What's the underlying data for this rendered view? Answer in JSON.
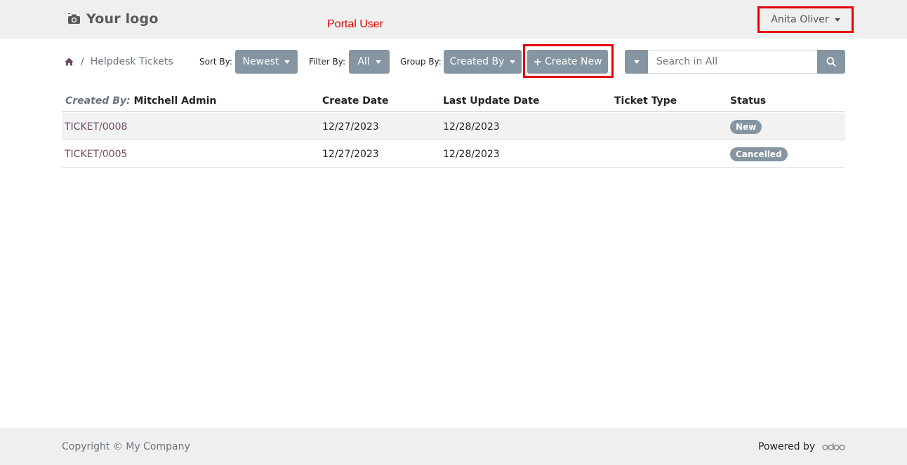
{
  "header": {
    "logo_text": "Your logo",
    "annotation": "Portal User",
    "user_name": "Anita Oliver"
  },
  "toolbar": {
    "breadcrumb": "Helpdesk Tickets",
    "sort_label": "Sort By:",
    "sort_value": "Newest",
    "filter_label": "Filter By:",
    "filter_value": "All",
    "group_label": "Group By:",
    "group_value": "Created By",
    "create_label": "Create New",
    "search_placeholder": "Search in All"
  },
  "table": {
    "group_label": "Created By:",
    "group_value": "Mitchell Admin",
    "columns": [
      "Create Date",
      "Last Update Date",
      "Ticket Type",
      "Status"
    ],
    "rows": [
      {
        "ticket": "TICKET/0008",
        "create_date": "12/27/2023",
        "update_date": "12/28/2023",
        "ticket_type": "",
        "status": "New"
      },
      {
        "ticket": "TICKET/0005",
        "create_date": "12/27/2023",
        "update_date": "12/28/2023",
        "ticket_type": "",
        "status": "Cancelled"
      }
    ]
  },
  "footer": {
    "copyright": "Copyright © My Company",
    "powered_by": "Powered by",
    "brand": "odoo"
  },
  "colors": {
    "accent_gray": "#8595a2",
    "link": "#714b67",
    "annotation_red": "#e30000"
  }
}
